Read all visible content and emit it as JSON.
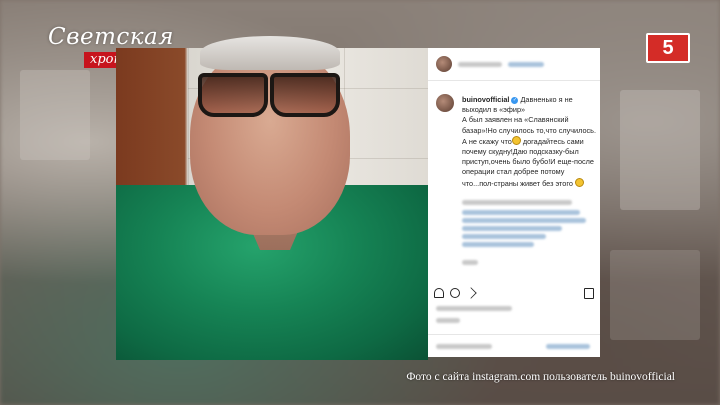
{
  "brand": {
    "title": "Светская",
    "subtitle": "хроника"
  },
  "channel_badge": "5",
  "post": {
    "username": "buinovofficial",
    "caption": [
      "Давненько я не выходил в «эфир»",
      "А был заявлен на «Славянский базар»!Но случилось то,что случилось.",
      "А не скажу что",
      "догадайтесь сами почему скудну!Даю подсказку-был приступ,очень было бубо!И еще-после операции стал добрее потому что...пол-страны живет без этого"
    ]
  },
  "credit": "Фото с сайта instagram.com пользователь buinovofficial",
  "icons": [
    "heart-icon",
    "comment-icon",
    "share-icon",
    "bookmark-icon"
  ],
  "colors": {
    "brand_red": "#c7141d",
    "channel_red": "#d42c27",
    "scrubs_green": "#168455",
    "instagram_blue": "#3897f0"
  }
}
